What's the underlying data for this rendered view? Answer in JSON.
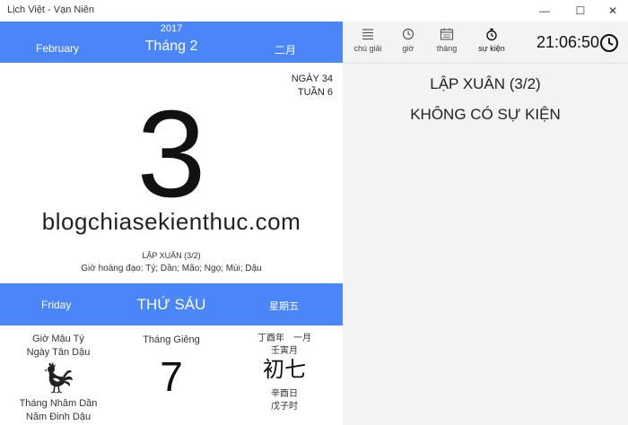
{
  "window": {
    "title": "Lịch Việt - Vạn Niên",
    "minimize_glyph": "—",
    "maximize_glyph": "☐",
    "close_glyph": "✕"
  },
  "header": {
    "year": "2017",
    "month_en": "February",
    "month_vi": "Tháng 2",
    "month_cn": "二月"
  },
  "day": {
    "day_of_year": "NGÀY 34",
    "week_of_year": "TUẦN 6",
    "number": "3",
    "watermark": "blogchiasekienthuc.com",
    "holiday": "LẬP XUÂN (3/2)",
    "good_hours": "Giờ hoàng đạo: Tý; Dần; Mão; Ngọ; Mùi; Dậu"
  },
  "weekday": {
    "en": "Friday",
    "vi": "THỨ SÁU",
    "cn": "星期五"
  },
  "lunar": {
    "hour": "Giờ Mậu Tý",
    "day": "Ngày Tân Dậu",
    "month": "Tháng Nhâm Dần",
    "year": "Năm Đinh Dậu",
    "zodiac_icon": "rooster-icon",
    "month_label": "Tháng Giêng",
    "day_number": "7",
    "cn_year_month": "丁酉年　一月",
    "cn_month_stem": "壬寅月",
    "cn_day": "初七",
    "cn_day_stem": "辛酉日",
    "cn_hour_stem": "戊子时"
  },
  "toolbar": {
    "items": [
      {
        "label": "chú giải",
        "icon": "list-icon"
      },
      {
        "label": "giờ",
        "icon": "clock-icon"
      },
      {
        "label": "tháng",
        "icon": "calendar-icon"
      },
      {
        "label": "sự kiện",
        "icon": "stopwatch-icon"
      }
    ],
    "clock": "21:06:50"
  },
  "events": {
    "title": "LẬP XUÂN (3/2)",
    "none": "KHÔNG CÓ SỰ KIỆN"
  },
  "colors": {
    "accent": "#4a86f7",
    "panel": "#f3f3f3"
  }
}
